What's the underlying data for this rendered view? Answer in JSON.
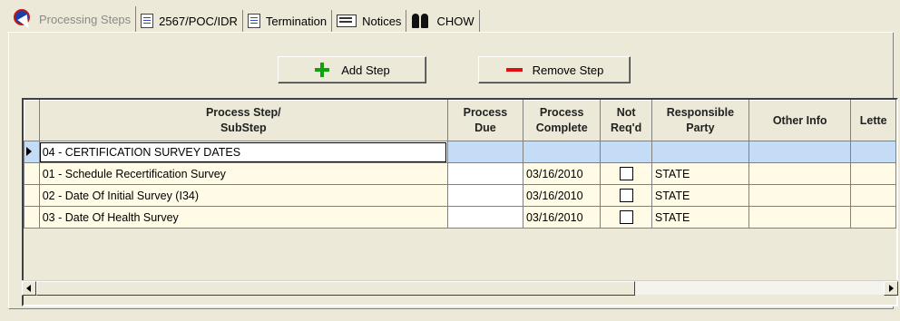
{
  "tabs": [
    {
      "label": "Processing Steps",
      "icon": "processing-steps-icon",
      "active": true
    },
    {
      "label": "2567/POC/IDR",
      "icon": "document-icon"
    },
    {
      "label": "Termination",
      "icon": "document-icon"
    },
    {
      "label": "Notices",
      "icon": "envelope-icon"
    },
    {
      "label": "CHOW",
      "icon": "people-icon"
    }
  ],
  "toolbar": {
    "add_label": "Add Step",
    "remove_label": "Remove Step"
  },
  "grid": {
    "headers": {
      "step_line1": "Process Step/",
      "step_line2": "SubStep",
      "due_line1": "Process",
      "due_line2": "Due",
      "complete_line1": "Process",
      "complete_line2": "Complete",
      "notreq_line1": "Not",
      "notreq_line2": "Req'd",
      "party_line1": "Responsible",
      "party_line2": "Party",
      "other": "Other Info",
      "letter": "Lette"
    },
    "group_row": {
      "step": "04 - CERTIFICATION SURVEY DATES"
    },
    "rows": [
      {
        "step": "01 - Schedule Recertification Survey",
        "due": "",
        "complete": "03/16/2010",
        "not_reqd": false,
        "party": "STATE"
      },
      {
        "step": "02 - Date Of Initial Survey (I34)",
        "due": "",
        "complete": "03/16/2010",
        "not_reqd": false,
        "party": "STATE"
      },
      {
        "step": "03 - Date Of Health Survey",
        "due": "",
        "complete": "03/16/2010",
        "not_reqd": false,
        "party": "STATE"
      }
    ]
  },
  "colors": {
    "group_row": "#c4dcf6",
    "data_row": "#fffbe6",
    "window_bg": "#ece9d8"
  }
}
